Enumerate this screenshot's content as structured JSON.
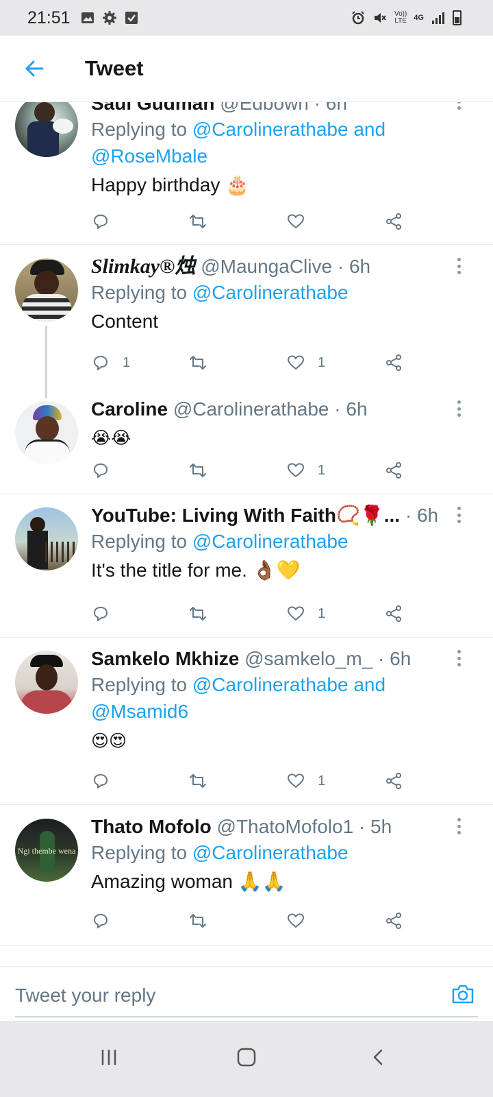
{
  "status": {
    "time": "21:51",
    "icons_left": [
      "image-icon",
      "gear-icon",
      "checkbox-icon"
    ],
    "icons_right": [
      "alarm-icon",
      "mute-icon",
      "volte-icon",
      "4g-icon",
      "signal-icon",
      "battery-icon"
    ],
    "volte": "Vo))\nLTE",
    "network": "4G"
  },
  "header": {
    "title": "Tweet",
    "back_icon": "back-arrow-icon"
  },
  "colors": {
    "accent": "#1da1f2",
    "secondary_text": "#657786",
    "divider": "#e1e8ed"
  },
  "tweets": [
    {
      "name": "Saul Gudman",
      "handle": "@Edbown",
      "time": "6h",
      "replying_prefix": "Replying to ",
      "replying_to": "@Carolinerathabe",
      "replying_and": " and",
      "replying_to_2": "@RoseMbale",
      "text": "Happy birthday 🎂",
      "reply_count": "",
      "like_count": ""
    },
    {
      "name": "Slimkay®烛",
      "handle": "@MaungaClive",
      "time": "6h",
      "replying_prefix": "Replying to ",
      "replying_to": "@Carolinerathabe",
      "text": "Content",
      "reply_count": "1",
      "like_count": "1"
    },
    {
      "name": "Caroline",
      "handle": "@Carolinerathabe",
      "time": "6h",
      "text": "😭😭",
      "reply_count": "",
      "like_count": "1"
    },
    {
      "name": "YouTube: Living With Faith📿🌹...",
      "handle": "",
      "time": "6h",
      "replying_prefix": "Replying to ",
      "replying_to": "@Carolinerathabe",
      "text": "It's the title for me. 👌🏾💛",
      "reply_count": "",
      "like_count": "1"
    },
    {
      "name": "Samkelo Mkhize",
      "handle": "@samkelo_m_",
      "time": "6h",
      "replying_prefix": "Replying to ",
      "replying_to": "@Carolinerathabe",
      "replying_and": " and",
      "replying_to_2": "@Msamid6",
      "text": "😍😍",
      "reply_count": "",
      "like_count": "1"
    },
    {
      "name": "Thato Mofolo",
      "handle": "@ThatoMofolo1",
      "time": "5h",
      "replying_prefix": "Replying to ",
      "replying_to": "@Carolinerathabe",
      "text": "Amazing woman 🙏🙏",
      "reply_count": "",
      "like_count": ""
    }
  ],
  "avatar_text": "Ngi thembe wena",
  "reply_bar": {
    "placeholder": "Tweet your reply",
    "camera_icon": "camera-icon"
  },
  "nav": {
    "recents_icon": "recents-icon",
    "home_icon": "home-icon",
    "back_icon": "back-icon"
  },
  "sep": " · "
}
